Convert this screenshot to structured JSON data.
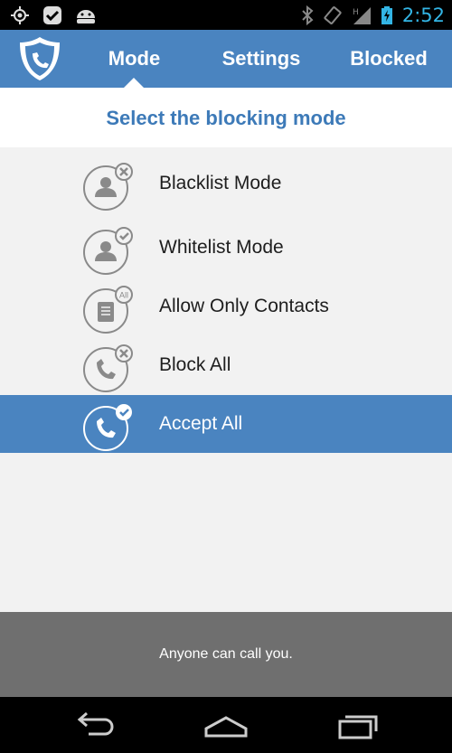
{
  "status_bar": {
    "time": "2:52",
    "icons": [
      "gps-icon",
      "check-notification-icon",
      "android-icon",
      "bluetooth-icon",
      "rotate-icon",
      "signal-icon",
      "battery-charging-icon"
    ]
  },
  "tabs": {
    "mode": "Mode",
    "settings": "Settings",
    "blocked": "Blocked",
    "active": "Mode"
  },
  "header": {
    "title": "Select the blocking mode"
  },
  "modes": [
    {
      "label": "Blacklist Mode",
      "icon": "person-blocked-icon",
      "selected": false
    },
    {
      "label": "Whitelist Mode",
      "icon": "person-allowed-icon",
      "selected": false
    },
    {
      "label": "Allow Only Contacts",
      "icon": "contacts-book-all-icon",
      "badge": "All",
      "selected": false
    },
    {
      "label": "Block All",
      "icon": "phone-blocked-icon",
      "selected": false
    },
    {
      "label": "Accept All",
      "icon": "phone-allowed-icon",
      "selected": true
    }
  ],
  "message": "Anyone can call you.",
  "navigation": [
    "back-icon",
    "home-icon",
    "recent-apps-icon"
  ],
  "colors": {
    "accent": "#4a84c0",
    "header_text": "#3d7ab8",
    "message_bar": "#6f6f6f",
    "clock": "#33b5e5"
  }
}
